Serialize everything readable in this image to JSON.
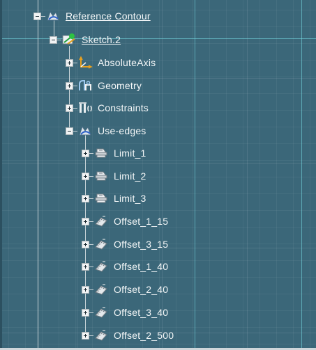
{
  "tree": {
    "root": {
      "label": "Reference Contour",
      "icon": "reference-contour-icon",
      "expanded": true
    },
    "sketch": {
      "label": "Sketch.2",
      "icon": "sketch-icon",
      "expanded": true
    },
    "children": [
      {
        "label": "AbsoluteAxis",
        "icon": "absolute-axis-icon",
        "expanded": false
      },
      {
        "label": "Geometry",
        "icon": "geometry-icon",
        "expanded": false
      },
      {
        "label": "Constraints",
        "icon": "constraints-icon",
        "expanded": false
      },
      {
        "label": "Use-edges",
        "icon": "use-edges-icon",
        "expanded": true
      }
    ],
    "use_edges": [
      {
        "label": "Limit_1",
        "icon": "limit-icon"
      },
      {
        "label": "Limit_2",
        "icon": "limit-icon"
      },
      {
        "label": "Limit_3",
        "icon": "limit-icon"
      },
      {
        "label": "Offset_1_15",
        "icon": "offset-icon"
      },
      {
        "label": "Offset_3_15",
        "icon": "offset-icon"
      },
      {
        "label": "Offset_1_40",
        "icon": "offset-icon"
      },
      {
        "label": "Offset_2_40",
        "icon": "offset-icon"
      },
      {
        "label": "Offset_3_40",
        "icon": "offset-icon"
      },
      {
        "label": "Offset_2_500",
        "icon": "offset-icon"
      }
    ]
  },
  "colors": {
    "background": "#3b6779",
    "text": "#f4f7f8",
    "axis": "#78dce6"
  }
}
